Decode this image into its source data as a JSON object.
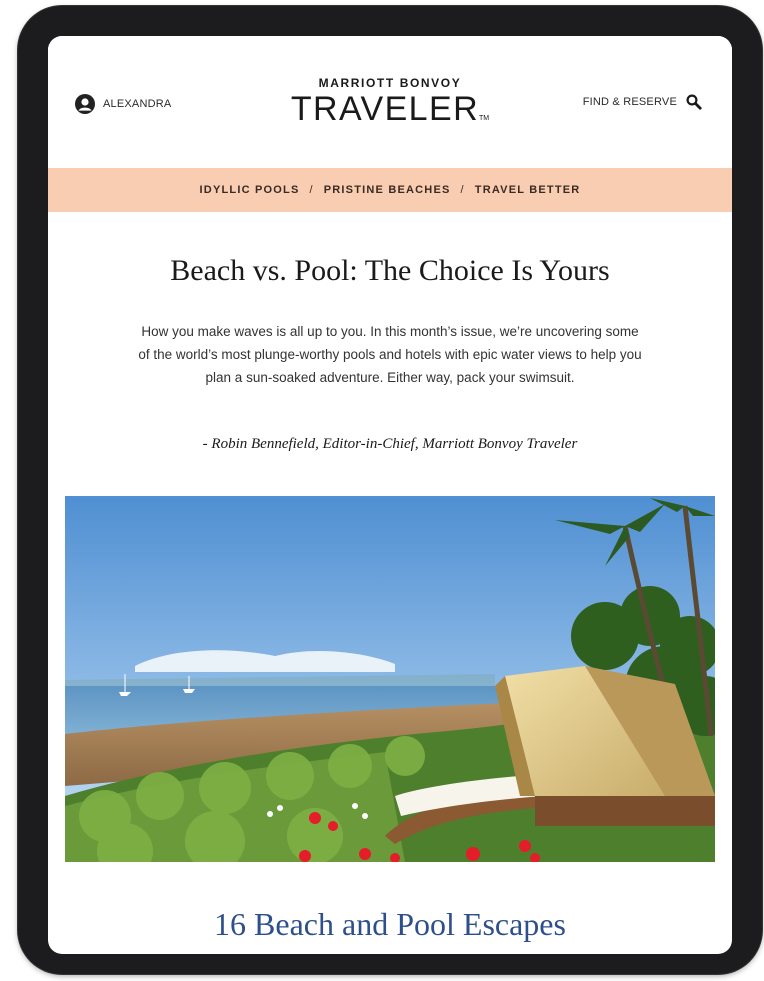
{
  "header": {
    "account_name": "ALEXANDRA",
    "brand_top_line": "MARRIOTT BONVOY",
    "brand_wordmark": "TRAVELER",
    "brand_tm": "TM",
    "find_label": "FIND & RESERVE"
  },
  "nav": {
    "items": [
      {
        "label": "IDYLLIC POOLS"
      },
      {
        "label": "PRISTINE BEACHES"
      },
      {
        "label": "TRAVEL BETTER"
      }
    ],
    "separator": "/",
    "band_color": "#f9cdb2"
  },
  "article": {
    "headline": "Beach vs. Pool: The Choice Is Yours",
    "intro": "How you make waves is all up to you. In this month’s issue, we’re uncovering some of the world’s most plunge-worthy pools and hotels with epic water views to help you plan a sun-soaked adventure. Either way, pack your swimsuit.",
    "byline": "- Robin Bennefield, Editor-in-Chief, Marriott Bonvoy Traveler"
  },
  "section": {
    "title": "16 Beach and Pool Escapes",
    "title_color": "#2e4f8c"
  },
  "icons": {
    "account": "user-avatar-icon",
    "search": "search-icon"
  }
}
